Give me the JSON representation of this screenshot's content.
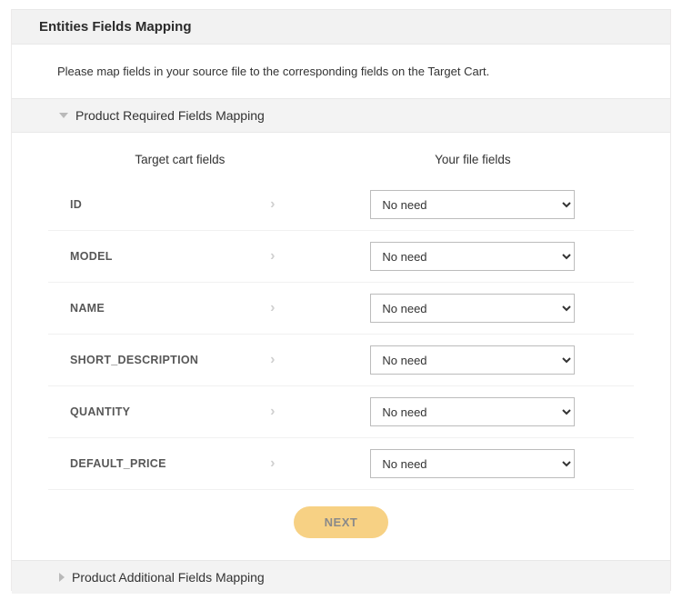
{
  "section": {
    "title": "Entities Fields Mapping",
    "instructions": "Please map fields in your source file to the corresponding fields on the Target Cart."
  },
  "panel_required": {
    "title": "Product Required Fields Mapping",
    "header_target": "Target cart fields",
    "header_file": "Your file fields",
    "rows": [
      {
        "label": "ID",
        "value": "No need"
      },
      {
        "label": "MODEL",
        "value": "No need"
      },
      {
        "label": "NAME",
        "value": "No need"
      },
      {
        "label": "SHORT_DESCRIPTION",
        "value": "No need"
      },
      {
        "label": "QUANTITY",
        "value": "No need"
      },
      {
        "label": "DEFAULT_PRICE",
        "value": "No need"
      }
    ],
    "next_label": "NEXT"
  },
  "panel_additional": {
    "title": "Product Additional Fields Mapping"
  },
  "select_option_default": "No need"
}
